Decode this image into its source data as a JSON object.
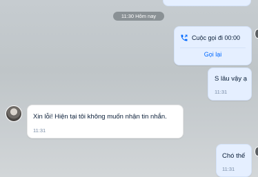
{
  "divider": {
    "time_label": "11:30 Hôm nay"
  },
  "messages": [
    {
      "type": "call",
      "direction": "sent",
      "call_label": "Cuộc gọi đi 00:00",
      "action_label": "Gọi lại",
      "icon": "outgoing-call-icon"
    },
    {
      "type": "text",
      "direction": "sent",
      "text": "S lâu vậy ạ",
      "time": "11:31"
    },
    {
      "type": "text",
      "direction": "received",
      "text": "Xin lỗi! Hiện tại tôi không muốn nhận tin nhắn.",
      "time": "11:31"
    },
    {
      "type": "text",
      "direction": "sent",
      "text": "Chó thế",
      "time": "11:31"
    }
  ],
  "colors": {
    "sent_bubble": "#e5efff",
    "received_bubble": "#ffffff",
    "accent_link": "#0068ff",
    "text_primary": "#081c36",
    "time_text": "#7589a3"
  }
}
